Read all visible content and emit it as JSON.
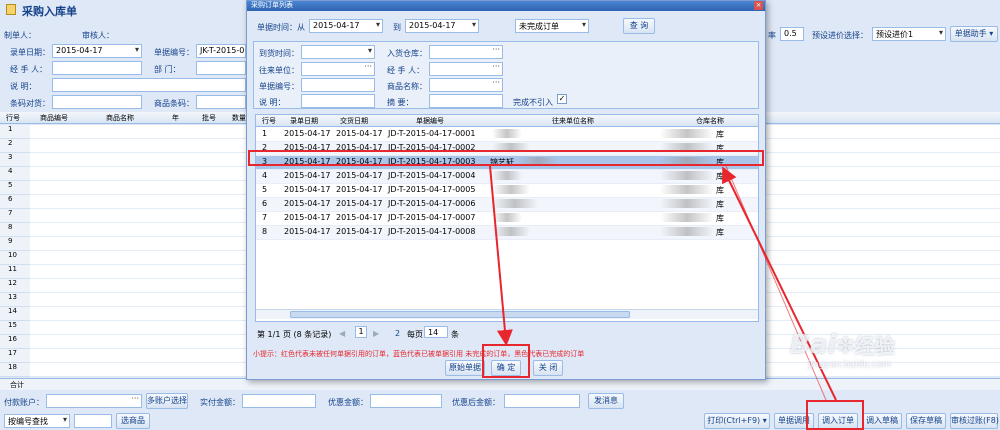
{
  "main": {
    "title": "采购入库单",
    "maker_label": "制单人：",
    "reviewer_label": "审核人：",
    "row1": {
      "date_label": "录单日期：",
      "date_value": "2015-04-17",
      "docno_label": "单据编号：",
      "docno_value": "JK-T-2015-0",
      "rate_label": "率",
      "rate_value": "0.5",
      "preset_label": "预设进价选择：",
      "preset_value": "预设进价1",
      "helper_button": "单据助手"
    },
    "row2": {
      "handler_label": "经 手 人：",
      "dept_label": "部    门："
    },
    "row3": {
      "note_label": "说    明："
    },
    "row4": {
      "barcode_check_label": "条码对货：",
      "barcode_label": "商品条码："
    },
    "grid_headers": [
      "行号",
      "商品编号",
      "商品名称",
      "年",
      "批号",
      "数量"
    ],
    "row_numbers": [
      "1",
      "2",
      "3",
      "4",
      "5",
      "6",
      "7",
      "8",
      "9",
      "10",
      "11",
      "12",
      "13",
      "14",
      "15",
      "16",
      "17",
      "18"
    ],
    "total_label": "合计",
    "footer": {
      "pay_account_label": "付款账户：",
      "multi_account_button": "多账户选择",
      "actual_paid_label": "实付金额：",
      "discount_label": "优惠金额：",
      "after_discount_label": "优惠后金额：",
      "send_msg_button": "发消息",
      "search_mode": "按编号查找",
      "select_goods_button": "选商品",
      "print_button": "打印(Ctrl+F9)",
      "doc_call_button": "单据调用",
      "import_order_button": "调入订单",
      "import_draft_button": "调入草稿",
      "save_draft_button": "保存草稿",
      "audit_post_button": "审核过账(F8)"
    }
  },
  "dialog": {
    "title": "采购订单列表",
    "filter": {
      "from_label": "单据时间：从",
      "from_value": "2015-04-17",
      "to_label": "到",
      "to_value": "2015-04-17",
      "status_value": "未完成订单",
      "query_button": "查 询"
    },
    "form": {
      "arrival_label": "到货时间：",
      "warehouse_label": "入货仓库：",
      "partner_label": "往来单位：",
      "handler_label": "经 手 人：",
      "docno_label": "单据编号：",
      "goods_label": "商品名称：",
      "note_label": "说    明：",
      "summary_label": "摘    要：",
      "exclude_label": "完成不引入",
      "exclude_checked": "✓"
    },
    "columns": [
      "行号",
      "录单日期",
      "交货日期",
      "单据编号",
      "往来单位名称",
      "仓库名称"
    ],
    "rows": [
      {
        "no": "1",
        "date": "2015-04-17",
        "delivery": "2015-04-17",
        "docno": "JD-T-2015-04-17-0001",
        "partner": "",
        "warehouse": "库"
      },
      {
        "no": "2",
        "date": "2015-04-17",
        "delivery": "2015-04-17",
        "docno": "JD-T-2015-04-17-0002",
        "partner": "",
        "warehouse": "库"
      },
      {
        "no": "3",
        "date": "2015-04-17",
        "delivery": "2015-04-17",
        "docno": "JD-T-2015-04-17-0003",
        "partner": "锦艺轩",
        "warehouse": "库"
      },
      {
        "no": "4",
        "date": "2015-04-17",
        "delivery": "2015-04-17",
        "docno": "JD-T-2015-04-17-0004",
        "partner": "",
        "warehouse": "库"
      },
      {
        "no": "5",
        "date": "2015-04-17",
        "delivery": "2015-04-17",
        "docno": "JD-T-2015-04-17-0005",
        "partner": "",
        "warehouse": "库"
      },
      {
        "no": "6",
        "date": "2015-04-17",
        "delivery": "2015-04-17",
        "docno": "JD-T-2015-04-17-0006",
        "partner": "",
        "warehouse": "库"
      },
      {
        "no": "7",
        "date": "2015-04-17",
        "delivery": "2015-04-17",
        "docno": "JD-T-2015-04-17-0007",
        "partner": "",
        "warehouse": "库"
      },
      {
        "no": "8",
        "date": "2015-04-17",
        "delivery": "2015-04-17",
        "docno": "JD-T-2015-04-17-0008",
        "partner": "",
        "warehouse": "库"
      }
    ],
    "pager": {
      "info": "第 1/1 页 (8 条记录)",
      "page": "1",
      "next_page": "2",
      "per_page_label": "每页",
      "per_page_value": "14",
      "unit": "条"
    },
    "hint": "小提示：红色代表未被任何单据引用的订单，蓝色代表已被单据引用    未完成的订单，黑色代表已完成的订单",
    "buttons": {
      "original": "原始单据",
      "confirm": "确 定",
      "close": "关 闭"
    }
  },
  "watermark": {
    "brand": "Bai",
    "brand_cn": "经验",
    "url": "jingyan.baidu.com"
  },
  "colors": {
    "highlight": "#e8262d",
    "selected_row": "#a9c5ea",
    "title_bar": "#2d63b1"
  }
}
